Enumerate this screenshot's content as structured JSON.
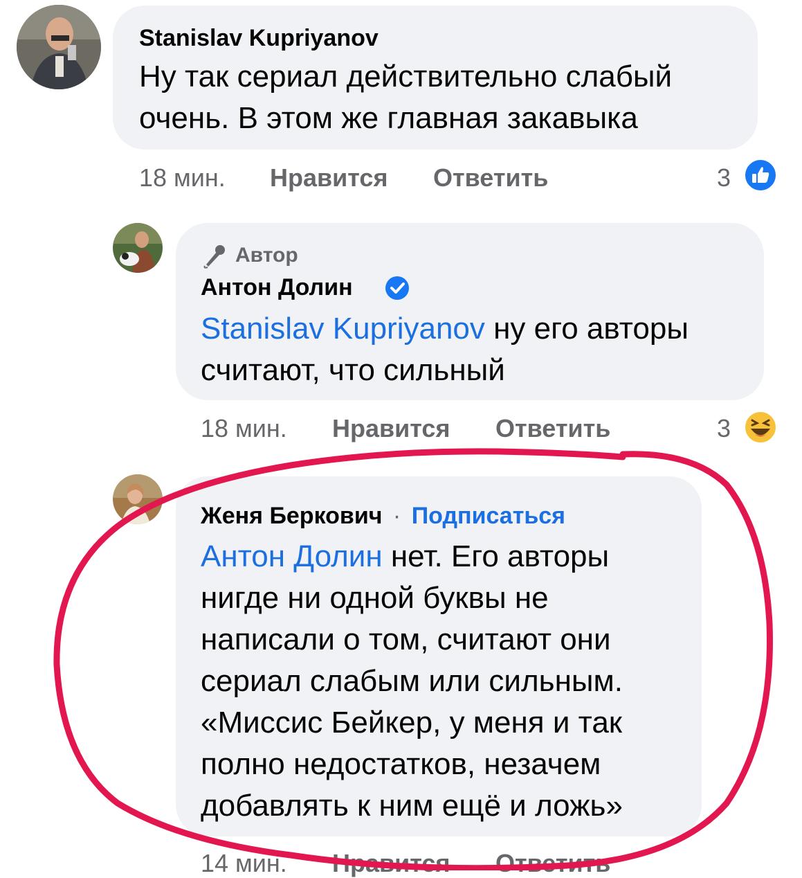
{
  "comments": [
    {
      "author": "Stanislav Kupriyanov",
      "text_lines": [
        "Ну так сериал действительно слабый",
        "очень. В этом же главная закавыка"
      ],
      "time": "18 мин.",
      "like_label": "Нравится",
      "reply_label": "Ответить",
      "reaction_count": "3",
      "reaction_icon": "like-icon"
    },
    {
      "author_badge": "Автор",
      "author": "Антон Долин",
      "verified": true,
      "mention": "Stanislav Kupriyanov",
      "text_line1_rest": " ну его авторы",
      "text_line2": "считают, что сильный",
      "time": "18 мин.",
      "like_label": "Нравится",
      "reply_label": "Ответить",
      "reaction_count": "3",
      "reaction_icon": "haha-icon"
    },
    {
      "author": "Женя Беркович",
      "separator": "·",
      "follow_label": "Подписаться",
      "mention": "Антон Долин",
      "text_line1_rest": " нет. Его авторы",
      "text_lines": [
        "нигде ни одной буквы не",
        "написали о том, считают они",
        "сериал слабым или сильным.",
        "«Миссис Бейкер, у меня и так",
        "полно недостатков, незачем",
        "добавлять к ним ещё и ложь»"
      ],
      "time": "14 мин.",
      "like_label": "Нравится",
      "reply_label": "Ответить"
    }
  ],
  "colors": {
    "bubble": "#f0f2f5",
    "link": "#1c6fe0",
    "meta": "#65676b",
    "highlight_circle": "#e3174f",
    "like_blue": "#1877f2"
  }
}
